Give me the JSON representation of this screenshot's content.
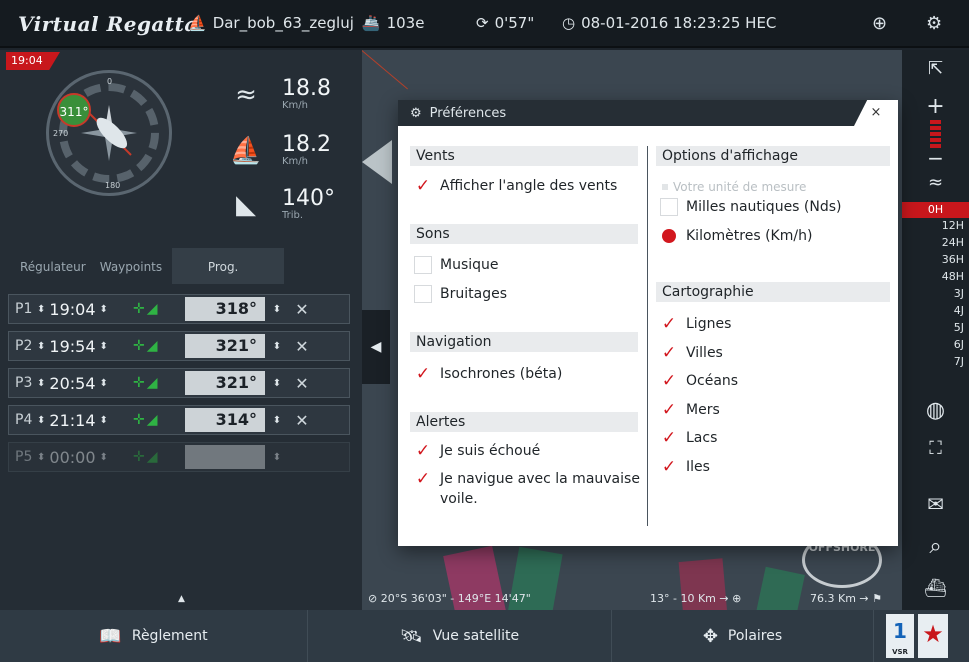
{
  "topbar": {
    "logo": "Virtual Regatta",
    "boat_name": "Dar_bob_63_zegluj",
    "rank": "103e",
    "refresh_timer": "0'57\"",
    "datetime": "08-01-2016 18:23:25 HEC"
  },
  "left_panel": {
    "race_time": "19:04",
    "compass_heading": "311°",
    "compass_labels": [
      "0",
      "270",
      "180"
    ],
    "wind_speed": "18.8",
    "wind_unit": "Km/h",
    "boat_speed": "18.2",
    "boat_unit": "Km/h",
    "wind_angle": "140°",
    "wind_angle_side": "Trib.",
    "tabs": [
      "Régulateur",
      "Waypoints",
      "Prog."
    ],
    "programs": [
      {
        "id": "P1",
        "time": "19:04",
        "angle": "318°",
        "enabled": true
      },
      {
        "id": "P2",
        "time": "19:54",
        "angle": "321°",
        "enabled": true
      },
      {
        "id": "P3",
        "time": "20:54",
        "angle": "321°",
        "enabled": true
      },
      {
        "id": "P4",
        "time": "21:14",
        "angle": "314°",
        "enabled": true
      },
      {
        "id": "P5",
        "time": "00:00",
        "angle": "",
        "enabled": false
      }
    ]
  },
  "dialog": {
    "title": "Préférences",
    "close_label": "×",
    "sections": {
      "vents": {
        "title": "Vents",
        "options": [
          {
            "label": "Afficher l'angle des vents",
            "checked": true
          }
        ]
      },
      "sons": {
        "title": "Sons",
        "options": [
          {
            "label": "Musique",
            "checked": false
          },
          {
            "label": "Bruitages",
            "checked": false
          }
        ]
      },
      "navigation": {
        "title": "Navigation",
        "options": [
          {
            "label": "Isochrones (béta)",
            "checked": true
          }
        ]
      },
      "alertes": {
        "title": "Alertes",
        "options": [
          {
            "label": "Je suis échoué",
            "checked": true
          },
          {
            "label": "Je navigue avec la mauvaise voile.",
            "checked": true
          }
        ]
      },
      "affichage": {
        "title": "Options d'affichage",
        "hint": "Votre unité de mesure",
        "units": [
          {
            "label": "Milles nautiques (Nds)",
            "selected": false
          },
          {
            "label": "Kilomètres (Km/h)",
            "selected": true
          }
        ]
      },
      "cartographie": {
        "title": "Cartographie",
        "options": [
          {
            "label": "Lignes",
            "checked": true
          },
          {
            "label": "Villes",
            "checked": true
          },
          {
            "label": "Océans",
            "checked": true
          },
          {
            "label": "Mers",
            "checked": true
          },
          {
            "label": "Lacs",
            "checked": true
          },
          {
            "label": "Iles",
            "checked": true
          }
        ]
      }
    }
  },
  "right_bar": {
    "forecast_times": [
      "0H",
      "12H",
      "24H",
      "36H",
      "48H",
      "3J",
      "4J",
      "5J",
      "6J",
      "7J"
    ],
    "active_time": "0H"
  },
  "map": {
    "coords": "20°S 36'03\" - 149°E 14'47\"",
    "scale": "13° - 10 Km",
    "distance": "76.3 Km",
    "offshore_label": "OFFSHORE"
  },
  "footer": {
    "rules_label": "Règlement",
    "satellite_label": "Vue satellite",
    "polars_label": "Polaires",
    "vsr_label": "1",
    "vsr_caption": "VSR"
  },
  "colors": {
    "accent_red": "#c8171c",
    "check_red": "#d2171e",
    "program_green": "#2fb344"
  }
}
